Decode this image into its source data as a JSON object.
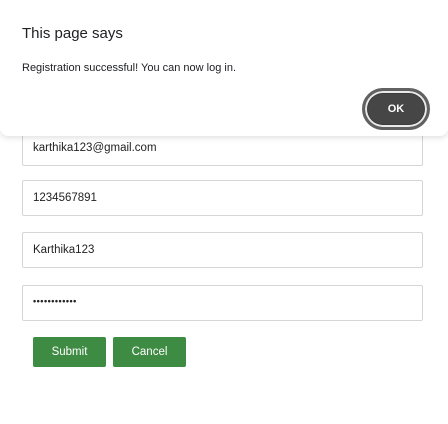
{
  "dialog": {
    "title": "This page says",
    "message": "Registration successful! You can now log in.",
    "ok_label": "OK"
  },
  "form": {
    "email_value": "karthika123@gmail.com",
    "phone_value": "1234567891",
    "username_value": "Karthika123",
    "password_masked": "••••••••••••",
    "submit_label": "Submit",
    "cancel_label": "Cancel"
  },
  "colors": {
    "button_green": "#3e8b43",
    "ok_button": "#464646"
  }
}
